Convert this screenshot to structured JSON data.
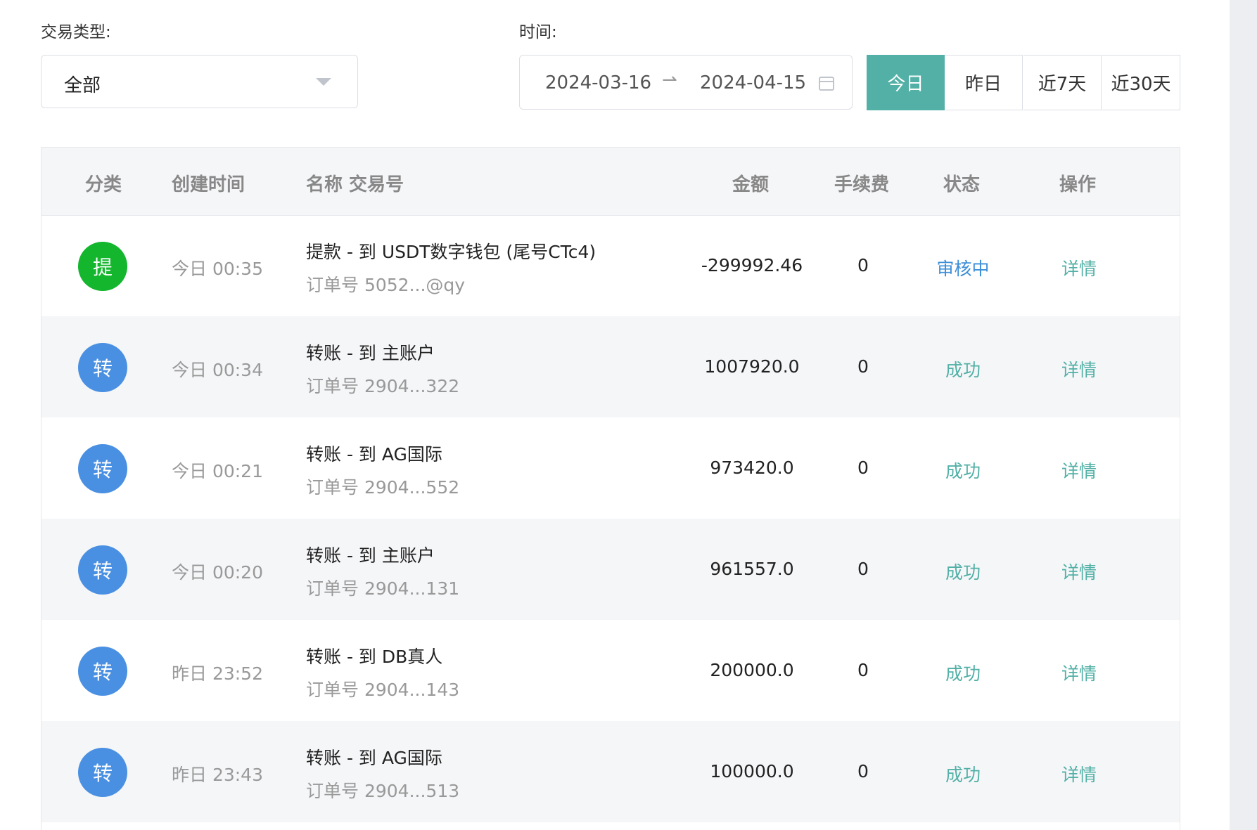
{
  "filters": {
    "type_label": "交易类型:",
    "type_value": "全部",
    "time_label": "时间:",
    "date_start": "2024-03-16",
    "date_end": "2024-04-15",
    "date_sep": "⇀",
    "quick": [
      "今日",
      "昨日",
      "近7天",
      "近30天"
    ],
    "quick_active": "今日"
  },
  "table": {
    "headers": {
      "category": "分类",
      "created": "创建时间",
      "name": "名称 交易号",
      "amount": "金额",
      "fee": "手续费",
      "status": "状态",
      "action": "操作"
    },
    "rows": [
      {
        "badge": "提",
        "badge_color": "#13b62d",
        "time": "今日 00:35",
        "name": "提款 - 到 USDT数字钱包 (尾号CTc4)",
        "order": "订单号 5052...@qy",
        "amount": "-299992.46",
        "fee": "0",
        "status": "审核中",
        "status_color": "#3d8fd8",
        "action": "详情"
      },
      {
        "badge": "转",
        "badge_color": "#4a90e2",
        "time": "今日 00:34",
        "name": "转账 - 到 主账户",
        "order": "订单号 2904...322",
        "amount": "1007920.0",
        "fee": "0",
        "status": "成功",
        "status_color": "#52b0a6",
        "action": "详情"
      },
      {
        "badge": "转",
        "badge_color": "#4a90e2",
        "time": "今日 00:21",
        "name": "转账 - 到 AG国际",
        "order": "订单号 2904...552",
        "amount": "973420.0",
        "fee": "0",
        "status": "成功",
        "status_color": "#52b0a6",
        "action": "详情"
      },
      {
        "badge": "转",
        "badge_color": "#4a90e2",
        "time": "今日 00:20",
        "name": "转账 - 到 主账户",
        "order": "订单号 2904...131",
        "amount": "961557.0",
        "fee": "0",
        "status": "成功",
        "status_color": "#52b0a6",
        "action": "详情"
      },
      {
        "badge": "转",
        "badge_color": "#4a90e2",
        "time": "昨日 23:52",
        "name": "转账 - 到 DB真人",
        "order": "订单号 2904...143",
        "amount": "200000.0",
        "fee": "0",
        "status": "成功",
        "status_color": "#52b0a6",
        "action": "详情"
      },
      {
        "badge": "转",
        "badge_color": "#4a90e2",
        "time": "昨日 23:43",
        "name": "转账 - 到 AG国际",
        "order": "订单号 2904...513",
        "amount": "100000.0",
        "fee": "0",
        "status": "成功",
        "status_color": "#52b0a6",
        "action": "详情"
      }
    ]
  },
  "colors": {
    "accent": "#52b0a6",
    "pending": "#3d8fd8",
    "withdraw_badge": "#13b62d",
    "transfer_badge": "#4a90e2"
  }
}
